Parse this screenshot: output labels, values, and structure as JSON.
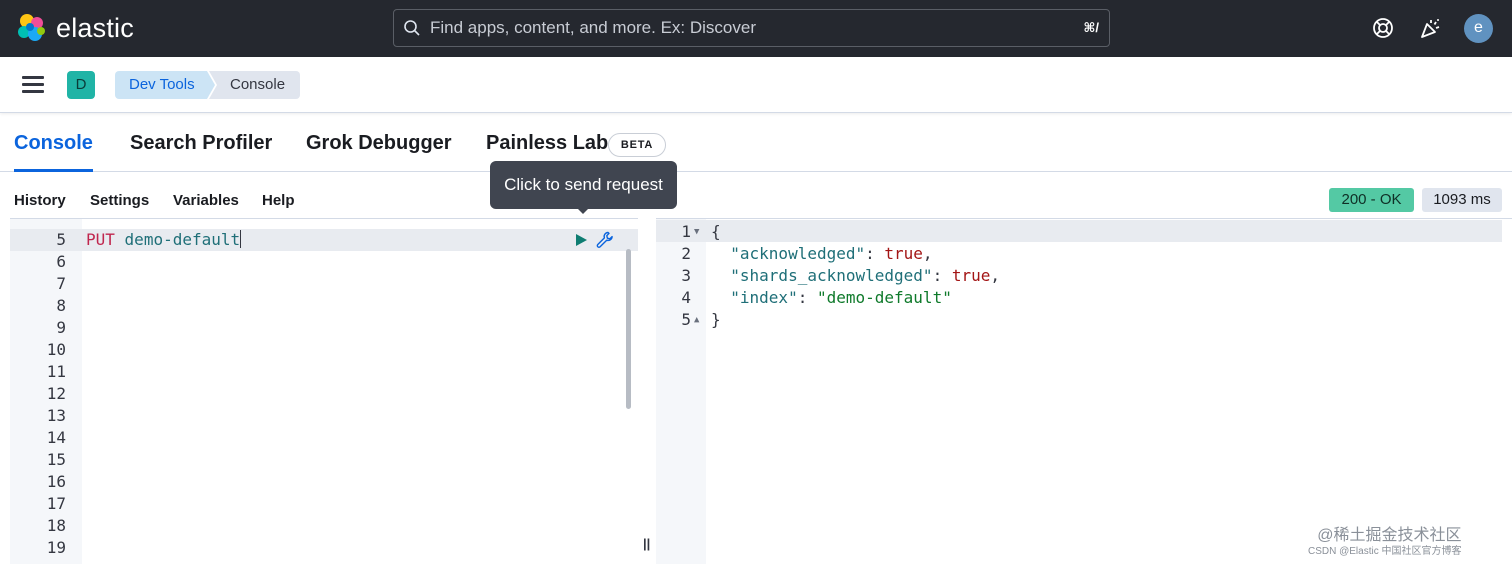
{
  "header": {
    "brand": "elastic",
    "search": {
      "placeholder": "Find apps, content, and more. Ex: Discover",
      "shortcut": "⌘/"
    },
    "icons": [
      "help-icon",
      "newsfeed-icon"
    ],
    "avatar_initial": "e"
  },
  "subbar": {
    "space_initial": "D",
    "breadcrumbs": [
      "Dev Tools",
      "Console"
    ]
  },
  "tabs": [
    {
      "label": "Console",
      "active": true
    },
    {
      "label": "Search Profiler",
      "active": false
    },
    {
      "label": "Grok Debugger",
      "active": false
    },
    {
      "label": "Painless Lab",
      "active": false,
      "badge": "BETA"
    }
  ],
  "toolbar": {
    "history": "History",
    "settings": "Settings",
    "variables": "Variables",
    "help": "Help",
    "status": "200 - OK",
    "time": "1093 ms"
  },
  "tooltip": "Click to send request",
  "editor": {
    "line_numbers": [
      "5",
      "6",
      "7",
      "8",
      "9",
      "10",
      "11",
      "12",
      "13",
      "14",
      "15",
      "16",
      "17",
      "18",
      "19"
    ],
    "request_method": "PUT",
    "request_path": "demo-default"
  },
  "output": {
    "line_numbers": [
      "1",
      "2",
      "3",
      "4",
      "5"
    ],
    "open_brace": "{",
    "close_brace": "}",
    "fields": [
      {
        "key": "\"acknowledged\"",
        "value": "true",
        "type": "bool",
        "trail": ","
      },
      {
        "key": "\"shards_acknowledged\"",
        "value": "true",
        "type": "bool",
        "trail": ","
      },
      {
        "key": "\"index\"",
        "value": "\"demo-default\"",
        "type": "str",
        "trail": ""
      }
    ]
  },
  "watermark": {
    "line1": "@稀土掘金技术社区",
    "line2": "CSDN @Elastic 中国社区官方博客"
  },
  "colors": {
    "header_bg": "#25282f",
    "accent": "#0b64dd",
    "status_ok": "#54c9a4"
  }
}
